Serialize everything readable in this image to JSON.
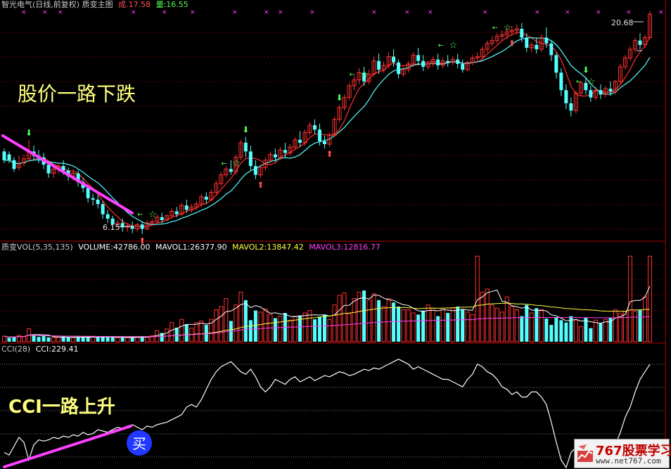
{
  "header": {
    "title": "智光电气(日线,前复权) 质变主图",
    "cost_label": "成",
    "cost_value": "17.58",
    "volume_label": "量",
    "volume_value": "16.55"
  },
  "annotations": {
    "price_text": "股价一路下跌",
    "cci_text": "CCI一路上升",
    "buy_label": "买",
    "high_price": "20.68",
    "low_price": "6.15"
  },
  "vol_header": {
    "name": "质变VOL(5,35,135)",
    "volume": "VOLUME:42786.00",
    "mavol1": "MAVOL1:26377.90",
    "mavol2": "MAVOL2:13847.42",
    "mavol3": "MAVOL3:12816.77"
  },
  "cci_header": {
    "name": "CCI(28)",
    "value": "CCI:229.41"
  },
  "watermark": {
    "brand": "767股票学习网",
    "url": "www.net767.com"
  },
  "colors": {
    "up": "#ff3232",
    "down": "#54ffff",
    "ma_fast": "#ff3030",
    "ma_slow": "#54ffff",
    "trend_line": "#ff40ff",
    "annotation_text": "#ffff80",
    "cci_line": "#ffffff",
    "buy_marker": "#2040ff"
  },
  "chart_data": [
    {
      "type": "candlestick",
      "title": "智光电气(日线,前复权) 质变主图",
      "ylim": [
        5.8,
        21.5
      ],
      "annotations": [
        "股价一路下跌",
        "20.68",
        "6.15"
      ],
      "candles": [
        [
          11.8,
          12.0,
          11.2,
          11.0
        ],
        [
          11.6,
          11.8,
          11.2,
          11.0
        ],
        [
          11.2,
          11.4,
          10.6,
          10.4
        ],
        [
          10.7,
          11.5,
          10.9,
          10.5
        ],
        [
          11.0,
          11.6,
          11.3,
          10.8
        ],
        [
          11.3,
          12.6,
          11.8,
          11.1
        ],
        [
          11.8,
          12.2,
          11.5,
          11.2
        ],
        [
          11.5,
          11.9,
          11.3,
          11.0
        ],
        [
          11.4,
          11.7,
          10.9,
          10.6
        ],
        [
          10.9,
          11.1,
          10.3,
          10.0
        ],
        [
          10.3,
          10.8,
          10.6,
          10.0
        ],
        [
          10.6,
          11.0,
          10.8,
          10.3
        ],
        [
          10.8,
          11.2,
          10.5,
          10.2
        ],
        [
          10.5,
          10.7,
          10.1,
          9.8
        ],
        [
          10.1,
          10.6,
          10.3,
          9.8
        ],
        [
          10.3,
          10.5,
          9.7,
          9.4
        ],
        [
          9.7,
          10.0,
          9.3,
          9.0
        ],
        [
          9.3,
          9.5,
          8.6,
          8.3
        ],
        [
          8.6,
          8.9,
          8.5,
          8.1
        ],
        [
          8.5,
          8.8,
          8.2,
          7.9
        ],
        [
          8.2,
          8.4,
          7.5,
          7.2
        ],
        [
          7.5,
          7.8,
          7.2,
          6.9
        ],
        [
          7.2,
          7.4,
          6.8,
          6.5
        ],
        [
          6.8,
          7.1,
          6.9,
          6.6
        ],
        [
          6.9,
          7.2,
          6.6,
          6.3
        ],
        [
          6.6,
          6.9,
          6.7,
          6.3
        ],
        [
          6.7,
          7.0,
          6.5,
          6.2
        ],
        [
          6.5,
          6.9,
          6.8,
          6.3
        ],
        [
          6.8,
          7.0,
          6.5,
          6.15
        ],
        [
          6.5,
          7.1,
          6.9,
          6.4
        ],
        [
          6.9,
          7.2,
          7.0,
          6.7
        ],
        [
          7.0,
          7.5,
          7.3,
          6.9
        ],
        [
          7.3,
          7.6,
          7.1,
          6.9
        ],
        [
          7.1,
          7.5,
          7.4,
          7.0
        ],
        [
          7.4,
          7.9,
          7.7,
          7.2
        ],
        [
          7.7,
          8.0,
          7.5,
          7.3
        ],
        [
          7.5,
          8.3,
          8.1,
          7.4
        ],
        [
          8.1,
          8.5,
          7.8,
          7.6
        ],
        [
          7.8,
          8.2,
          8.0,
          7.6
        ],
        [
          8.0,
          8.4,
          8.2,
          7.8
        ],
        [
          8.2,
          8.9,
          8.7,
          8.0
        ],
        [
          8.7,
          9.0,
          8.5,
          8.2
        ],
        [
          8.5,
          9.2,
          9.0,
          8.4
        ],
        [
          9.0,
          9.8,
          9.6,
          8.8
        ],
        [
          9.6,
          10.4,
          10.2,
          9.4
        ],
        [
          10.2,
          10.8,
          10.6,
          10.0
        ],
        [
          10.6,
          11.2,
          10.4,
          10.2
        ],
        [
          10.4,
          11.6,
          11.4,
          10.2
        ],
        [
          11.4,
          12.6,
          12.4,
          11.2
        ],
        [
          12.4,
          12.8,
          11.8,
          11.4
        ],
        [
          11.8,
          12.2,
          10.8,
          10.5
        ],
        [
          10.8,
          11.2,
          10.2,
          9.9
        ],
        [
          10.2,
          10.9,
          10.7,
          10.0
        ],
        [
          10.7,
          11.4,
          11.2,
          10.5
        ],
        [
          11.2,
          11.8,
          11.6,
          11.0
        ],
        [
          11.6,
          12.0,
          11.4,
          11.1
        ],
        [
          11.4,
          12.1,
          11.9,
          11.2
        ],
        [
          11.9,
          12.4,
          11.7,
          11.4
        ],
        [
          11.7,
          12.3,
          12.1,
          11.5
        ],
        [
          12.1,
          12.8,
          12.6,
          11.9
        ],
        [
          12.6,
          13.2,
          12.4,
          12.1
        ],
        [
          12.4,
          13.3,
          13.1,
          12.2
        ],
        [
          13.1,
          13.8,
          13.6,
          12.9
        ],
        [
          13.6,
          14.0,
          13.3,
          13.0
        ],
        [
          13.3,
          13.7,
          12.5,
          12.2
        ],
        [
          12.5,
          12.9,
          12.3,
          12.0
        ],
        [
          12.3,
          13.1,
          12.9,
          12.1
        ],
        [
          12.9,
          14.2,
          14.0,
          12.8
        ],
        [
          14.0,
          15.0,
          14.8,
          13.8
        ],
        [
          14.8,
          15.7,
          15.5,
          14.6
        ],
        [
          15.5,
          16.5,
          16.3,
          15.3
        ],
        [
          16.3,
          17.0,
          16.7,
          16.0
        ],
        [
          16.7,
          17.5,
          17.2,
          16.4
        ],
        [
          17.2,
          17.6,
          16.6,
          16.3
        ],
        [
          16.6,
          17.4,
          17.1,
          16.4
        ],
        [
          17.1,
          18.3,
          18.0,
          16.9
        ],
        [
          18.0,
          18.5,
          17.4,
          17.1
        ],
        [
          17.4,
          18.0,
          17.7,
          17.2
        ],
        [
          17.7,
          18.6,
          18.3,
          17.5
        ],
        [
          18.3,
          18.8,
          17.9,
          17.6
        ],
        [
          17.9,
          18.1,
          17.1,
          16.8
        ],
        [
          17.1,
          17.6,
          17.4,
          16.9
        ],
        [
          17.4,
          18.0,
          17.8,
          17.2
        ],
        [
          17.8,
          18.6,
          18.4,
          17.6
        ],
        [
          18.4,
          18.9,
          18.0,
          17.7
        ],
        [
          18.0,
          18.4,
          17.6,
          17.3
        ],
        [
          17.6,
          18.0,
          17.8,
          17.4
        ],
        [
          17.8,
          18.3,
          18.1,
          17.6
        ],
        [
          18.1,
          18.5,
          17.7,
          17.4
        ],
        [
          17.7,
          18.2,
          18.0,
          17.5
        ],
        [
          18.0,
          18.4,
          17.9,
          17.6
        ],
        [
          17.9,
          18.3,
          18.1,
          17.7
        ],
        [
          18.1,
          18.5,
          17.8,
          17.5
        ],
        [
          17.8,
          18.1,
          17.4,
          17.2
        ],
        [
          17.4,
          18.0,
          17.9,
          17.3
        ],
        [
          17.9,
          18.4,
          18.2,
          17.7
        ],
        [
          18.2,
          18.6,
          18.3,
          17.9
        ],
        [
          18.3,
          19.0,
          18.8,
          18.1
        ],
        [
          18.8,
          19.4,
          19.2,
          18.6
        ],
        [
          19.2,
          19.7,
          19.4,
          19.0
        ],
        [
          19.4,
          19.9,
          19.7,
          19.2
        ],
        [
          19.7,
          20.1,
          19.8,
          19.4
        ],
        [
          19.8,
          20.3,
          20.0,
          19.5
        ],
        [
          20.0,
          20.4,
          20.1,
          19.7
        ],
        [
          20.1,
          20.5,
          20.2,
          19.8
        ],
        [
          20.2,
          20.6,
          19.6,
          19.3
        ],
        [
          19.6,
          19.9,
          18.9,
          18.6
        ],
        [
          18.9,
          19.3,
          19.1,
          18.6
        ],
        [
          19.1,
          19.6,
          18.8,
          18.5
        ],
        [
          18.8,
          19.8,
          19.6,
          18.6
        ],
        [
          19.6,
          20.3,
          19.2,
          18.9
        ],
        [
          19.2,
          19.4,
          18.4,
          18.0
        ],
        [
          18.4,
          18.6,
          17.2,
          16.8
        ],
        [
          17.2,
          17.5,
          16.0,
          15.6
        ],
        [
          16.0,
          16.4,
          15.1,
          14.7
        ],
        [
          15.1,
          15.5,
          14.6,
          14.2
        ],
        [
          14.6,
          16.0,
          15.8,
          14.4
        ],
        [
          15.8,
          16.6,
          16.5,
          15.6
        ],
        [
          16.5,
          16.9,
          16.0,
          15.7
        ],
        [
          16.0,
          16.3,
          15.5,
          15.2
        ],
        [
          15.5,
          16.2,
          16.0,
          15.3
        ],
        [
          16.0,
          16.4,
          15.7,
          15.4
        ],
        [
          15.7,
          16.3,
          16.1,
          15.5
        ],
        [
          16.1,
          16.6,
          15.9,
          15.6
        ],
        [
          15.9,
          16.7,
          16.6,
          15.7
        ],
        [
          16.6,
          17.8,
          17.6,
          16.4
        ],
        [
          17.6,
          18.4,
          18.2,
          17.4
        ],
        [
          18.2,
          19.0,
          18.8,
          18.0
        ],
        [
          18.8,
          19.6,
          19.4,
          18.6
        ],
        [
          19.4,
          19.9,
          19.1,
          18.8
        ],
        [
          19.1,
          19.8,
          19.6,
          18.9
        ],
        [
          19.6,
          21.4,
          21.2,
          19.5
        ]
      ]
    },
    {
      "type": "bar",
      "title": "质变VOL(5,35,135)",
      "series": [
        {
          "name": "VOLUME",
          "value": 42786.0
        },
        {
          "name": "MAVOL1",
          "value": 26377.9
        },
        {
          "name": "MAVOL2",
          "value": 13847.42
        },
        {
          "name": "MAVOL3",
          "value": 12816.77
        }
      ],
      "ylim": [
        0,
        45000
      ],
      "values": [
        2800,
        2000,
        2400,
        3200,
        2600,
        6500,
        3000,
        2400,
        2800,
        2200,
        2000,
        2200,
        2600,
        2200,
        2000,
        2400,
        2200,
        2600,
        2400,
        2200,
        2600,
        2200,
        2400,
        2000,
        2200,
        2000,
        2400,
        2200,
        2800,
        2200,
        3000,
        5600,
        4400,
        6400,
        9600,
        7000,
        11200,
        8800,
        6800,
        9600,
        10400,
        8400,
        11200,
        16000,
        17600,
        21600,
        10400,
        18400,
        24800,
        20800,
        10800,
        15600,
        14800,
        16400,
        13600,
        11800,
        12800,
        14400,
        10800,
        12800,
        13200,
        14400,
        15600,
        11200,
        12400,
        13600,
        11200,
        18400,
        23200,
        24400,
        14000,
        21600,
        24800,
        25600,
        20800,
        24000,
        20800,
        17600,
        21600,
        19600,
        17600,
        16000,
        16000,
        14400,
        13600,
        15600,
        18400,
        16800,
        12800,
        16800,
        14400,
        16800,
        17600,
        16000,
        14800,
        13600,
        42786,
        24800,
        26400,
        18400,
        16800,
        14800,
        22400,
        17600,
        16000,
        12800,
        18400,
        14400,
        16800,
        16000,
        11600,
        8400,
        12000,
        10800,
        9600,
        12800,
        10800,
        7600,
        12000,
        6800,
        10800,
        9200,
        11200,
        12000,
        16000,
        14000,
        15200,
        42786,
        15200,
        16000,
        22400,
        42786
      ],
      "ups": [
        1,
        0,
        0,
        1,
        1,
        1,
        0,
        0,
        0,
        0,
        1,
        1,
        0,
        0,
        1,
        0,
        0,
        0,
        1,
        0,
        0,
        0,
        0,
        1,
        0,
        1,
        0,
        1,
        0,
        1,
        1,
        1,
        0,
        1,
        1,
        0,
        1,
        0,
        1,
        1,
        1,
        0,
        1,
        1,
        1,
        1,
        0,
        1,
        1,
        0,
        0,
        0,
        1,
        1,
        1,
        0,
        1,
        0,
        1,
        1,
        0,
        1,
        1,
        0,
        0,
        0,
        1,
        1,
        1,
        1,
        1,
        1,
        1,
        0,
        1,
        1,
        0,
        1,
        1,
        0,
        0,
        1,
        1,
        1,
        0,
        0,
        1,
        1,
        0,
        1,
        0,
        1,
        0,
        0,
        1,
        1,
        1,
        1,
        1,
        1,
        1,
        1,
        1,
        1,
        1,
        0,
        0,
        1,
        0,
        1,
        0,
        0,
        0,
        0,
        0,
        0,
        1,
        1,
        0,
        0,
        1,
        0,
        1,
        0,
        1,
        1,
        1,
        1,
        1,
        0,
        1,
        1
      ]
    },
    {
      "type": "line",
      "title": "CCI(28)",
      "series": [
        {
          "name": "CCI",
          "value": 229.41
        }
      ],
      "ylim": [
        -180,
        280
      ],
      "annotations": [
        "CCI一路上升",
        "买"
      ],
      "values": [
        -120,
        -130,
        -95,
        -60,
        -80,
        -150,
        -90,
        -70,
        -75,
        -70,
        -60,
        -65,
        -55,
        -60,
        -50,
        -55,
        -40,
        -50,
        -45,
        -30,
        -35,
        -40,
        -30,
        -20,
        -25,
        -15,
        -10,
        -20,
        -30,
        -15,
        -20,
        -10,
        -5,
        0,
        10,
        20,
        30,
        60,
        70,
        60,
        90,
        130,
        170,
        200,
        220,
        230,
        240,
        220,
        200,
        190,
        210,
        180,
        140,
        120,
        140,
        170,
        160,
        150,
        170,
        180,
        160,
        170,
        180,
        165,
        175,
        185,
        180,
        190,
        200,
        195,
        185,
        190,
        200,
        210,
        205,
        215,
        210,
        220,
        230,
        240,
        250,
        240,
        230,
        210,
        220,
        210,
        200,
        190,
        180,
        170,
        170,
        160,
        150,
        140,
        170,
        190,
        230,
        220,
        200,
        190,
        170,
        140,
        130,
        110,
        120,
        100,
        100,
        120,
        120,
        100,
        70,
        0,
        -80,
        -150,
        -180,
        -120,
        -100,
        -90,
        -100,
        -80,
        -100,
        -90,
        -70,
        -80,
        -90,
        -40,
        20,
        60,
        120,
        170,
        200,
        229.41
      ]
    }
  ]
}
